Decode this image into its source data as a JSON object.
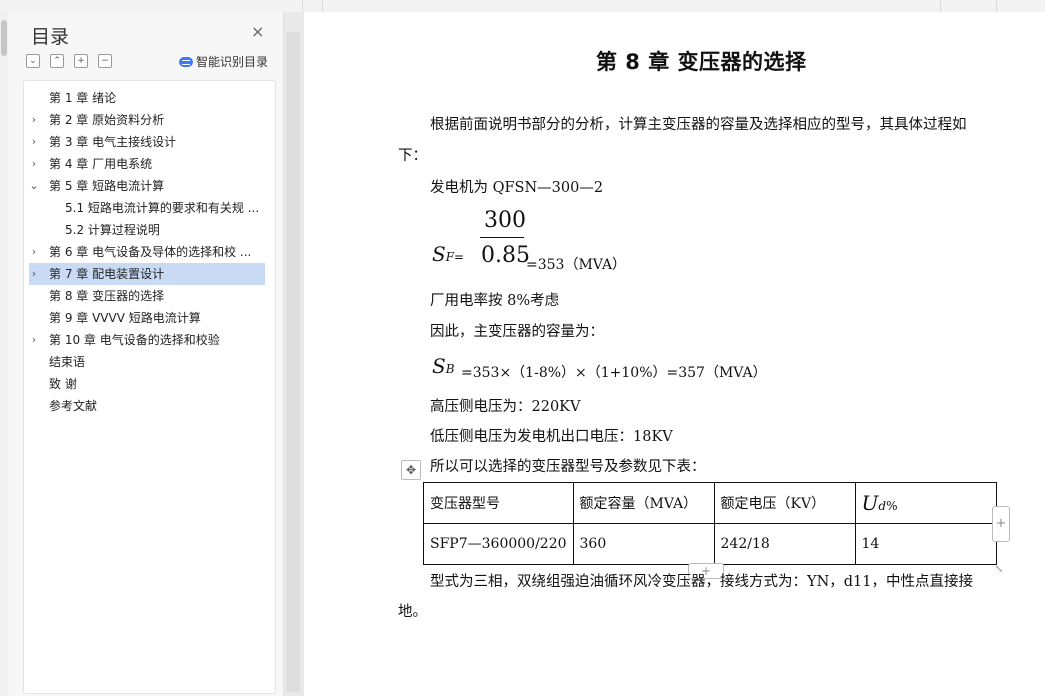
{
  "sidebar": {
    "title": "目录",
    "close_icon": "×",
    "tools": [
      "⌄",
      "⌃",
      "+",
      "−"
    ],
    "smart_label": "智能识别目录",
    "items": [
      {
        "label": "第 1 章  绪论",
        "arrow": "",
        "level": 0
      },
      {
        "label": "第 2 章  原始资料分析",
        "arrow": "›",
        "level": 0
      },
      {
        "label": "第 3 章  电气主接线设计",
        "arrow": "›",
        "level": 0
      },
      {
        "label": "第 4 章  厂用电系统",
        "arrow": "›",
        "level": 0
      },
      {
        "label": "第 5 章  短路电流计算",
        "arrow": "⌄",
        "level": 0
      },
      {
        "label": "5.1  短路电流计算的要求和有关规 ...",
        "arrow": "",
        "level": 1
      },
      {
        "label": "5.2  计算过程说明",
        "arrow": "",
        "level": 1
      },
      {
        "label": "第 6 章  电气设备及导体的选择和校 ...",
        "arrow": "›",
        "level": 0
      },
      {
        "label": "第 7 章  配电装置设计",
        "arrow": "›",
        "level": 0,
        "active": true
      },
      {
        "label": "第 8 章  变压器的选择",
        "arrow": "",
        "level": 0
      },
      {
        "label": "第 9 章  VVVV  短路电流计算",
        "arrow": "",
        "level": 0
      },
      {
        "label": "第 10 章  电气设备的选择和校验",
        "arrow": "›",
        "level": 0
      },
      {
        "label": "结束语",
        "arrow": "",
        "level": 0
      },
      {
        "label": "致    谢",
        "arrow": "",
        "level": 0
      },
      {
        "label": "参考文献",
        "arrow": "",
        "level": 0
      }
    ]
  },
  "document": {
    "heading": "第 8 章  变压器的选择",
    "p1a": "根据前面说明书部分的分析，计算主变压器的容量及选择相应的型号，其具体过程如",
    "p1b": "下：",
    "p2": "发电机为 QFSN—300—2",
    "frac_num": "300",
    "frac_den": "0.85",
    "sf_symbol": "S",
    "sf_sub": "F",
    "sf_eq": "=",
    "sf_result": "=353（MVA）",
    "p3": "厂用电率按 8%考虑",
    "p4": "因此，主变压器的容量为：",
    "sb_symbol": "S",
    "sb_sub": "B",
    "sb_formula": "=353×（1-8%）×（1+10%）=357（MVA）",
    "p5": "高压侧电压为：220KV",
    "p6": "低压侧电压为发电机出口电压：18KV",
    "p7": "所以可以选择的变压器型号及参数见下表：",
    "table": {
      "headers": [
        "变压器型号",
        "额定容量（MVA）",
        "额定电压（KV）"
      ],
      "ud_symbol": "U",
      "ud_sub": "d",
      "ud_pct": "%",
      "row": [
        "SFP7—360000/220",
        "360",
        "242/18",
        "14"
      ]
    },
    "p8a": "型式为三相，双绕组强迫油循环风冷变压器，接线方式为：YN，d11，中性点直接接",
    "p8b": "地。"
  },
  "controls": {
    "move_icon": "✥",
    "add_col": "+",
    "add_row": "+",
    "resize_icon": "⤡"
  }
}
